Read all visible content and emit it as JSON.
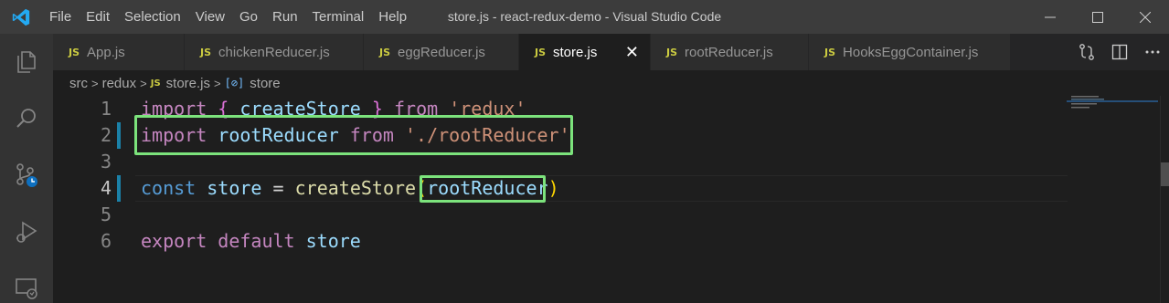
{
  "window": {
    "title": "store.js - react-redux-demo - Visual Studio Code",
    "logo_icon": "vscode-logo-icon",
    "accent": "#23a9f2"
  },
  "menu": [
    "File",
    "Edit",
    "Selection",
    "View",
    "Go",
    "Run",
    "Terminal",
    "Help"
  ],
  "tabs": [
    {
      "label": "App.js",
      "badge": "JS",
      "active": false
    },
    {
      "label": "chickenReducer.js",
      "badge": "JS",
      "active": false
    },
    {
      "label": "eggReducer.js",
      "badge": "JS",
      "active": false
    },
    {
      "label": "store.js",
      "badge": "JS",
      "active": true,
      "close": "✕"
    },
    {
      "label": "rootReducer.js",
      "badge": "JS",
      "active": false
    },
    {
      "label": "HooksEggContainer.js",
      "badge": "JS",
      "active": false
    }
  ],
  "breadcrumbs": {
    "items": [
      "src",
      "redux",
      "store.js",
      "store"
    ],
    "file_badge": "JS",
    "symbol_badge": "[⊘]"
  },
  "editor": {
    "lines": [
      {
        "num": "1",
        "tokens": {
          "import": "import",
          "lbrace": "{",
          "name": "createStore",
          "rbrace": "}",
          "from": "from",
          "src": "'redux'"
        }
      },
      {
        "num": "2",
        "tokens": {
          "import": "import",
          "name": "rootReducer",
          "from": "from",
          "src": "'./rootReducer'"
        }
      },
      {
        "num": "3"
      },
      {
        "num": "4",
        "tokens": {
          "const": "const",
          "name": "store",
          "eq": "=",
          "fn": "createStore",
          "lparen": "(",
          "arg": "rootReducer",
          "rparen": ")"
        }
      },
      {
        "num": "5"
      },
      {
        "num": "6",
        "tokens": {
          "export": "export",
          "default": "default",
          "name": "store"
        }
      }
    ],
    "current_line": "4"
  },
  "highlight_color": "#7ce37c"
}
